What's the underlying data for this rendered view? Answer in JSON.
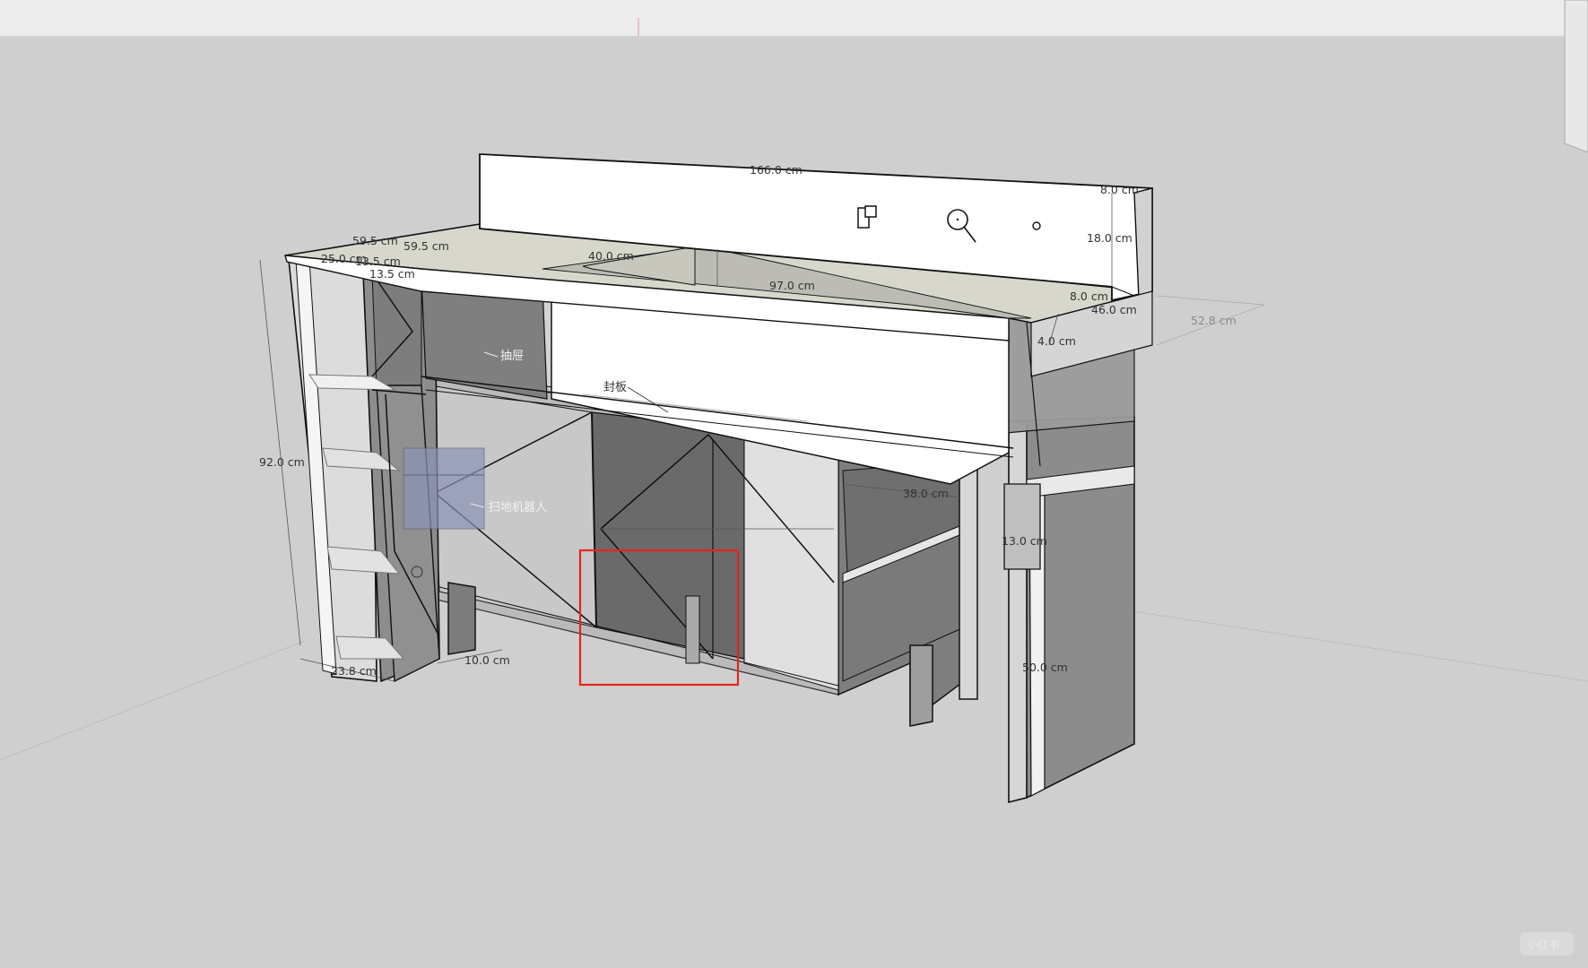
{
  "app": {
    "name": "SketchUp-style 3D viewport"
  },
  "dimensions": {
    "top_length": "166.0 cm",
    "backsplash_thickness": "8.0 cm",
    "backsplash_height": "18.0 cm",
    "sink_width": "40.0 cm",
    "counter_front_length": "97.0 cm",
    "left_depth_a": "59.5 cm",
    "left_depth_b": "59.5 cm",
    "left_width_25": "25.0 cm",
    "left_width_13a": "13.5 cm",
    "left_width_13b": "13.5 cm",
    "right_a": "8.0 cm",
    "right_b": "46.0 cm",
    "right_c": "4.0 cm",
    "depth_faint": "52.8 cm",
    "height_total": "92.0 cm",
    "left_bottom_width": "23.8 cm",
    "gap_bottom": "10.0 cm",
    "shelf_width": "38.0 cm",
    "notch_height": "13.0 cm",
    "leg_height": "50.0 cm"
  },
  "annotations": {
    "drawer": "抽屉",
    "seal_panel": "封板",
    "robot_vacuum": "扫地机器人"
  },
  "selection": {
    "color": "#e8231c"
  },
  "watermark": "小红书"
}
